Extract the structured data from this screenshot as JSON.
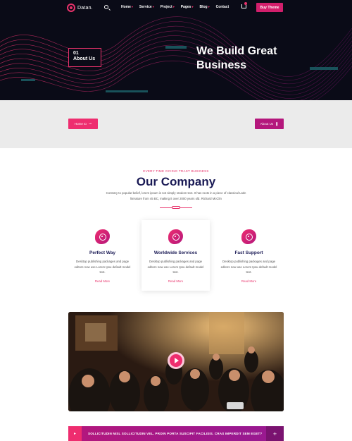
{
  "header": {
    "logo_text": "Datan.",
    "menu": [
      {
        "label": "Home",
        "has_caret": true,
        "active": true
      },
      {
        "label": "Service",
        "has_caret": true
      },
      {
        "label": "Project",
        "has_caret": true
      },
      {
        "label": "Pages",
        "has_caret": true
      },
      {
        "label": "Blog",
        "has_caret": true
      },
      {
        "label": "Contact",
        "has_caret": false
      }
    ],
    "buy_label": "Buy Theme"
  },
  "hero": {
    "badge_number": "01",
    "badge_label": "About Us",
    "title": "We Build Great Business"
  },
  "breadcrumb": {
    "home_label": "Home to",
    "current_label": "About Us"
  },
  "company": {
    "eyebrow": "EVERY TIME GIVING TRAST BUSINESS",
    "title": "Our Company",
    "description": "Contrary to popular belief, lorem ipsum is not simply random text. It has roots in a piece of classical Latin literature from 45 BC, making it over 2000 years old. Richard McClin",
    "cards": [
      {
        "title": "Perfect Way",
        "text": "Desktop publishing packages and page editors now use Lorem Ipsu default model text.",
        "more": "Read More"
      },
      {
        "title": "Worldwide Services",
        "text": "Desktop publishing packages and page editors now use Lorem Ipsu default model text.",
        "more": "Read More"
      },
      {
        "title": "Fast Support",
        "text": "Desktop publishing packages and page editors now use Lorem Ipsu default model text.",
        "more": "Read More"
      }
    ]
  },
  "faq": {
    "question": "SOLLICITUDIN NISL SOLLICITUDIN VEL. PROIN PORTA SUSCIPIT FACILISIS. CRAS IMPERDIT SEM EGET?"
  },
  "colors": {
    "accent": "#e8326b",
    "accent_dark": "#b4177c",
    "navy": "#1a1a55",
    "hero_bg": "#0a0b17",
    "band_bg": "#ebebeb"
  },
  "icons": [
    "search-icon",
    "cart-icon",
    "play-icon",
    "plus-icon",
    "chevron-down-icon"
  ]
}
